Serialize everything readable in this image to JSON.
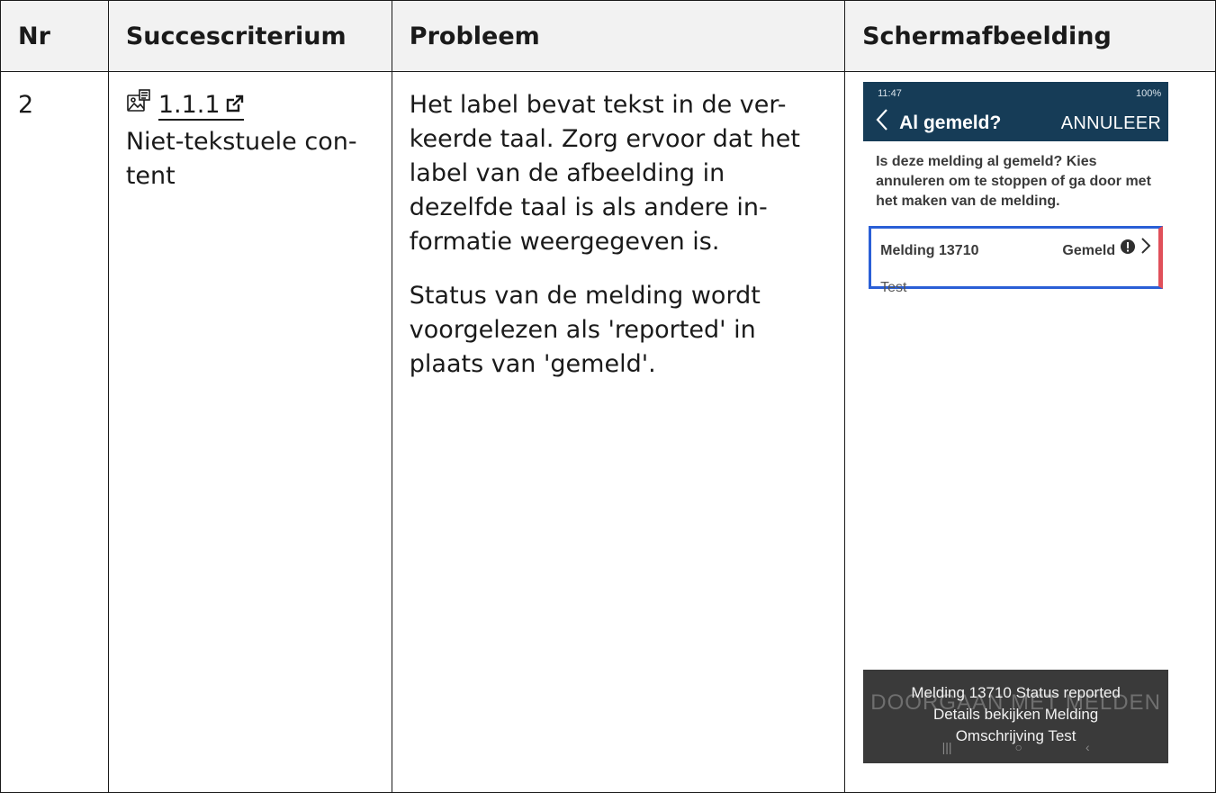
{
  "headers": {
    "nr": "Nr",
    "criterion": "Succescriterium",
    "problem": "Probleem",
    "screenshot": "Schermafbeelding"
  },
  "row": {
    "nr": "2",
    "criterion_code": "1.1.1",
    "criterion_name": "Niet-tekstuele con-tent",
    "problem_p1": "Het label bevat tekst in de ver-keerde taal. Zorg ervoor dat het label van de afbeelding in dezelfde taal is als andere in-formatie weergegeven is.",
    "problem_p2": "Status van de melding wordt voorgelezen als 'reported' in plaats van 'gemeld'."
  },
  "phone": {
    "time": "11:47",
    "battery": "100%",
    "title": "Al gemeld?",
    "cancel": "ANNULEER",
    "intro": "Is deze melding al gemeld? Kies annuleren om te stoppen of ga door met het maken van de melding.",
    "card_title": "Melding 13710",
    "card_status": "Gemeld",
    "card_sub": "Test",
    "background_button": "DOORGAAN MET MELDEN",
    "toast_line1": "Melding 13710 Status reported",
    "toast_line2": "Details bekijken Melding",
    "toast_line3": "Omschrijving Test"
  },
  "icons": {
    "criterion_type": "image-text-icon",
    "external_link": "external-link-icon",
    "warning": "exclamation-circle-icon",
    "chevron": "chevron-right-icon",
    "back": "chevron-left-icon"
  },
  "colors": {
    "header_bg": "#f2f2f2",
    "appbar": "#163c57",
    "focus_border": "#2a5fd6",
    "card_accent": "#e0505a"
  }
}
